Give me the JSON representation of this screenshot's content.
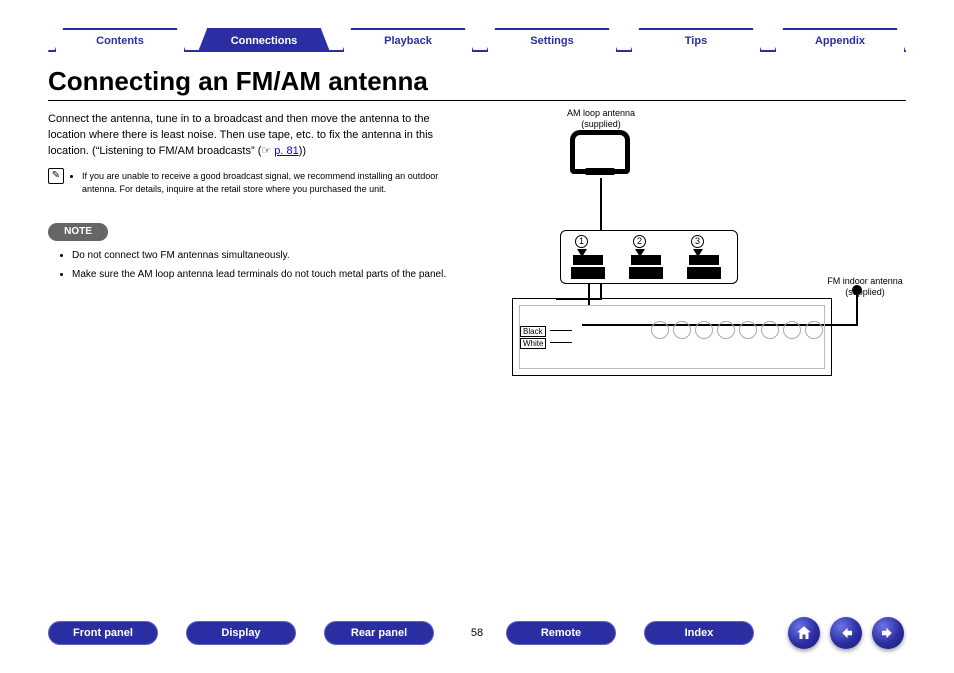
{
  "tabs": {
    "contents": {
      "label": "Contents"
    },
    "connections": {
      "label": "Connections",
      "active": true
    },
    "playback": {
      "label": "Playback"
    },
    "settings": {
      "label": "Settings"
    },
    "tips": {
      "label": "Tips"
    },
    "appendix": {
      "label": "Appendix"
    }
  },
  "title": "Connecting an FM/AM antenna",
  "intro": {
    "text": "Connect the antenna, tune in to a broadcast and then move the antenna to the location where there is least noise. Then use tape, etc. to fix the antenna in this location. (“Listening to FM/AM broadcasts” (☞ ",
    "link": "p. 81",
    "tail": "))"
  },
  "pencil_icon": "✎",
  "info_items": [
    "If you are unable to receive a good broadcast signal, we recommend installing an outdoor antenna. For details, inquire at the retail store where you purchased the unit."
  ],
  "note_label": "NOTE",
  "note_items": [
    "Do not connect two FM antennas simultaneously.",
    "Make sure the AM loop antenna lead terminals do not touch metal parts of the panel."
  ],
  "diagram": {
    "am_label_1": "AM loop antenna",
    "am_label_2": "(supplied)",
    "fm_label_1": "FM indoor antenna",
    "fm_label_2": "(supplied)",
    "black_label": "Black",
    "white_label": "White",
    "step1": "1",
    "step2": "2",
    "step3": "3"
  },
  "bottom": {
    "front": "Front panel",
    "display": "Display",
    "rear": "Rear panel",
    "remote": "Remote",
    "index": "Index"
  },
  "page_number": "58"
}
